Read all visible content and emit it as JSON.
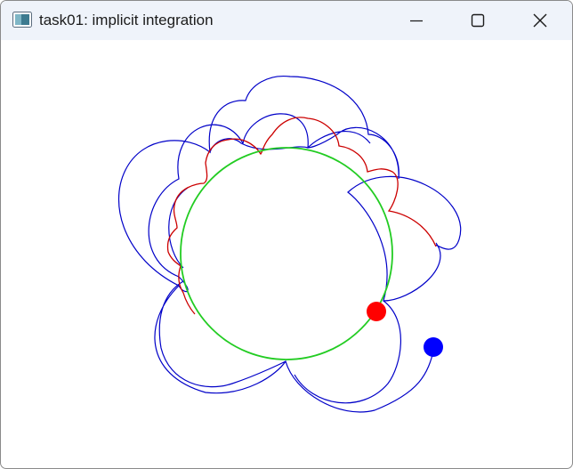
{
  "window": {
    "title": "task01: implicit integration",
    "app_icon": "app-window-icon",
    "controls": {
      "minimize_icon": "minimize-icon",
      "maximize_icon": "maximize-icon",
      "close_icon": "close-icon"
    }
  },
  "scene": {
    "colors": {
      "titlebar_bg": "#eff3fa",
      "blue_trajectory": "#0000c8",
      "red_trajectory": "#cc0000",
      "constraint_circle": "#22cc22",
      "red_ball": "#ff0000",
      "blue_ball": "#0000ff"
    },
    "elements": [
      "constraint-circle",
      "blue-trajectory",
      "red-trajectory",
      "red-ball",
      "blue-ball"
    ]
  }
}
